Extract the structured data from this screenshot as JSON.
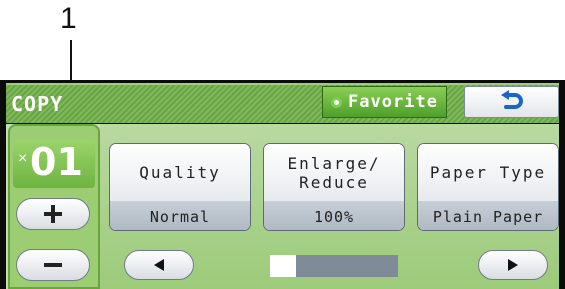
{
  "callout": {
    "label": "1"
  },
  "header": {
    "title": "COPY",
    "favorite_label": "Favorite",
    "back_icon": "back-arrow-icon"
  },
  "copies": {
    "prefix": "×",
    "value": "01",
    "plus_icon": "plus-icon",
    "minus_icon": "minus-icon"
  },
  "options": [
    {
      "label": "Quality",
      "value": "Normal"
    },
    {
      "label": "Enlarge/\nReduce",
      "value": "100%"
    },
    {
      "label": "Paper Type",
      "value": "Plain Paper"
    }
  ],
  "nav": {
    "prev_icon": "left-triangle-icon",
    "next_icon": "right-triangle-icon",
    "scroll_position": 0.2
  },
  "colors": {
    "accent_green": "#6aa346",
    "favorite_green": "#4e9f2c",
    "back_arrow_blue": "#1a66c7"
  }
}
